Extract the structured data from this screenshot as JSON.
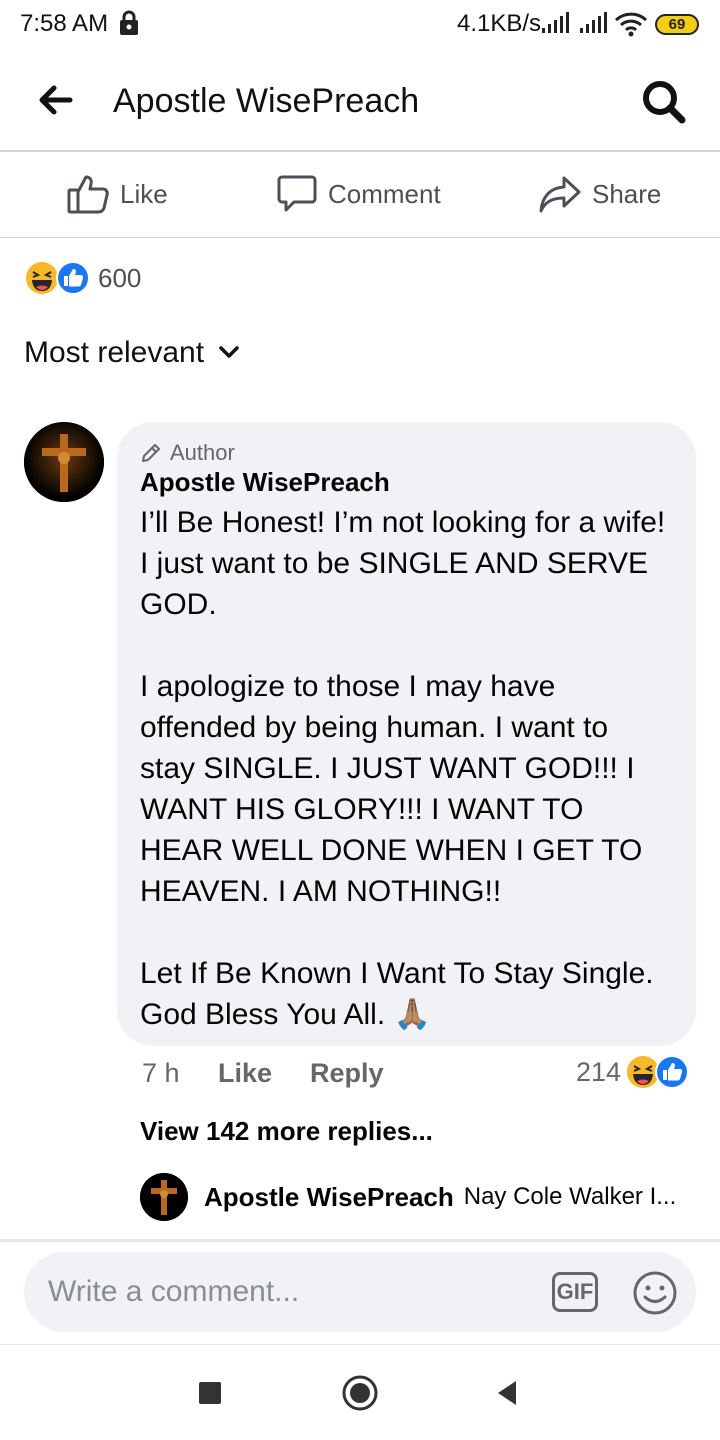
{
  "status_bar": {
    "time": "7:58 AM",
    "network_speed": "4.1KB/s",
    "battery_level": "69",
    "icons": [
      "lock-icon",
      "signal-icon",
      "signal-icon",
      "wifi-icon",
      "battery-icon"
    ]
  },
  "header": {
    "title": "Apostle WisePreach",
    "back_icon": "arrow-left-icon",
    "search_icon": "search-icon"
  },
  "actions": {
    "like": "Like",
    "comment": "Comment",
    "share": "Share"
  },
  "reactions": {
    "count": "600",
    "icons": [
      "haha-reaction-icon",
      "like-reaction-icon"
    ]
  },
  "sort": {
    "label": "Most relevant"
  },
  "comment": {
    "badge": "Author",
    "author": "Apostle WisePreach",
    "body": "I’ll Be Honest! I’m not looking for a wife! I just want to be SINGLE AND SERVE GOD.\n\nI apologize to those I may have offended by being human. I want to stay SINGLE. I JUST WANT GOD!!! I WANT HIS GLORY!!! I WANT TO HEAR WELL DONE WHEN I GET TO HEAVEN. I AM NOTHING!!\n\nLet If Be Known I Want To Stay Single. God Bless You All. 🙏🏽",
    "time": "7 h",
    "like": "Like",
    "reply": "Reply",
    "reaction_count": "214"
  },
  "replies": {
    "view_more": "View 142 more replies...",
    "preview_author": "Apostle WisePreach",
    "preview_text": "Nay Cole Walker I..."
  },
  "composer": {
    "placeholder": "Write a comment...",
    "gif_label": "GIF"
  },
  "colors": {
    "like_blue": "#1877f2",
    "haha_yellow": "#f7b928",
    "bubble_gray": "#f0f2f5",
    "secondary_text": "#65676b"
  }
}
